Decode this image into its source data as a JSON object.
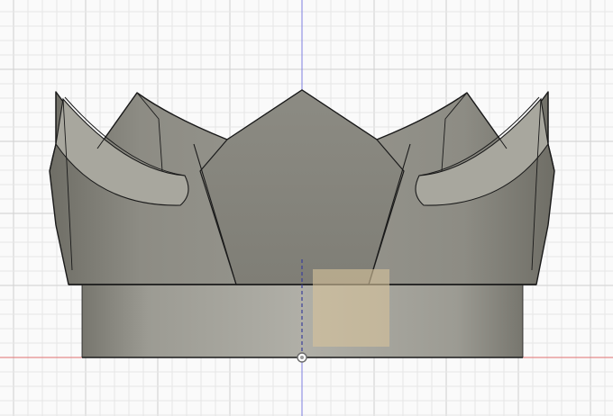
{
  "viewport": {
    "background_color": "#fafafa",
    "grid_minor_color": "#e6e6e6",
    "grid_major_color": "#cfcfcf",
    "axis_vertical_color": "#7d7fe0",
    "axis_horizontal_color": "#e07070"
  },
  "model": {
    "name": "crown",
    "body_color": "#8c8b82",
    "band_color": "#a4a39b",
    "edge_color": "#1a1a1a",
    "selection_color": "#d7c39b"
  },
  "icons": {
    "origin_marker": "origin-point-icon"
  }
}
